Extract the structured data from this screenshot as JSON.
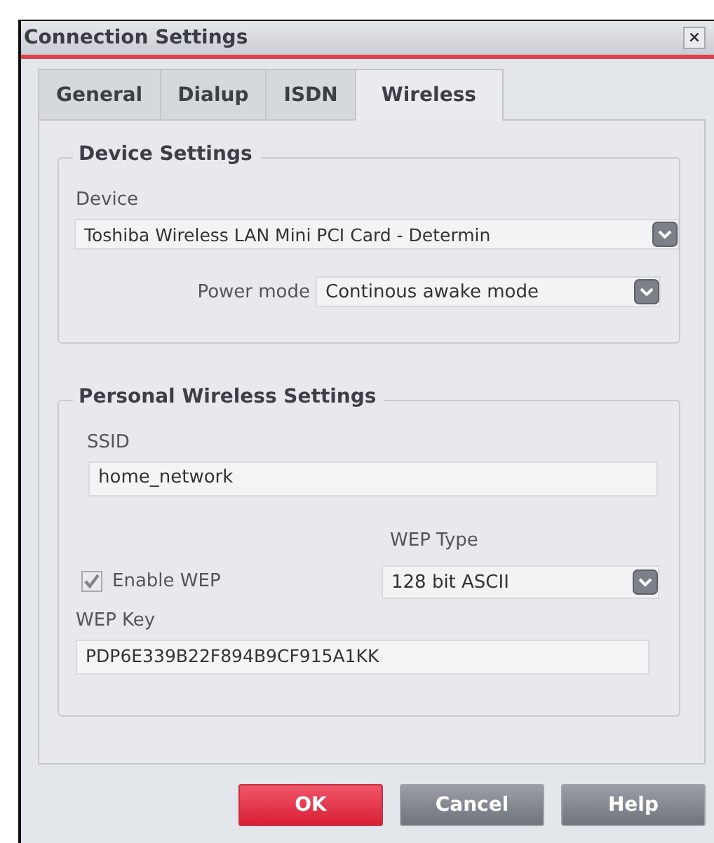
{
  "window": {
    "title": "Connection Settings",
    "close": "×"
  },
  "tabs": [
    {
      "label": "General",
      "selected": false
    },
    {
      "label": "Dialup",
      "selected": false
    },
    {
      "label": "ISDN",
      "selected": false
    },
    {
      "label": "Wireless",
      "selected": true
    }
  ],
  "device_settings": {
    "title": "Device Settings",
    "device_label": "Device",
    "device": "Toshiba Wireless LAN Mini PCI Card - Determin",
    "power_label": "Power mode",
    "power_mode": "Continous awake mode"
  },
  "personal_settings": {
    "title": "Personal  Wireless Settings",
    "ssid_label": "SSID",
    "ssid": "home_network",
    "enable_wep": {
      "label": "Enable WEP",
      "checked": true
    },
    "wep_type_label": "WEP Type",
    "wep_type": "128 bit ASCII",
    "wep_key_label": "WEP Key",
    "wep_key": "PDP6E339B22F894B9CF915A1KK"
  },
  "buttons": [
    {
      "label": "OK",
      "default": true
    },
    {
      "label": "Cancel",
      "default": false
    },
    {
      "label": "Help",
      "default": false
    }
  ]
}
